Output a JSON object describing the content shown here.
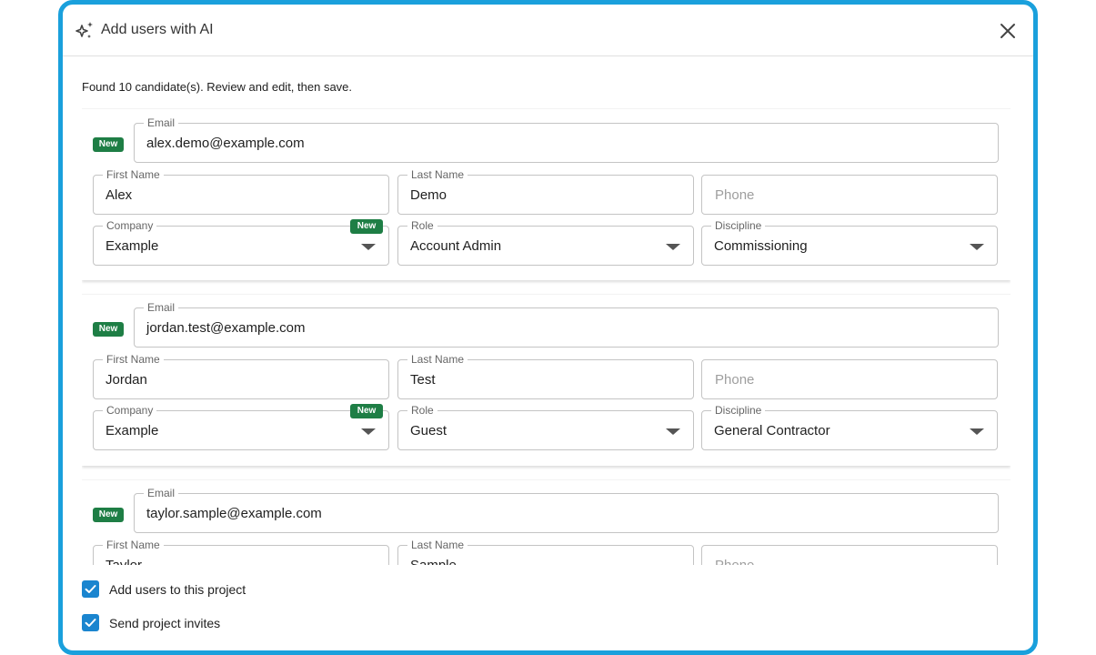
{
  "dialog": {
    "title": "Add users with AI",
    "summary": "Found 10 candidate(s). Review and edit, then save."
  },
  "labels": {
    "email": "Email",
    "first_name": "First Name",
    "last_name": "Last Name",
    "phone_placeholder": "Phone",
    "company": "Company",
    "role": "Role",
    "discipline": "Discipline",
    "new_badge": "New"
  },
  "candidates": [
    {
      "email": "alex.demo@example.com",
      "first_name": "Alex",
      "last_name": "Demo",
      "company": "Example",
      "role": "Account Admin",
      "discipline": "Commissioning"
    },
    {
      "email": "jordan.test@example.com",
      "first_name": "Jordan",
      "last_name": "Test",
      "company": "Example",
      "role": "Guest",
      "discipline": "General Contractor"
    },
    {
      "email": "taylor.sample@example.com",
      "first_name": "Taylor",
      "last_name": "Sample"
    }
  ],
  "options": {
    "add_to_project": {
      "label": "Add users to this project",
      "checked": true
    },
    "send_invites": {
      "label": "Send project invites",
      "checked": true
    }
  },
  "colors": {
    "accent_border": "#1aa0dc",
    "new_badge": "#1e7e45",
    "checkbox": "#1a85cf"
  },
  "icons": [
    "sparkle-icon",
    "close-icon",
    "dropdown-arrow-icon",
    "checkmark-icon"
  ]
}
